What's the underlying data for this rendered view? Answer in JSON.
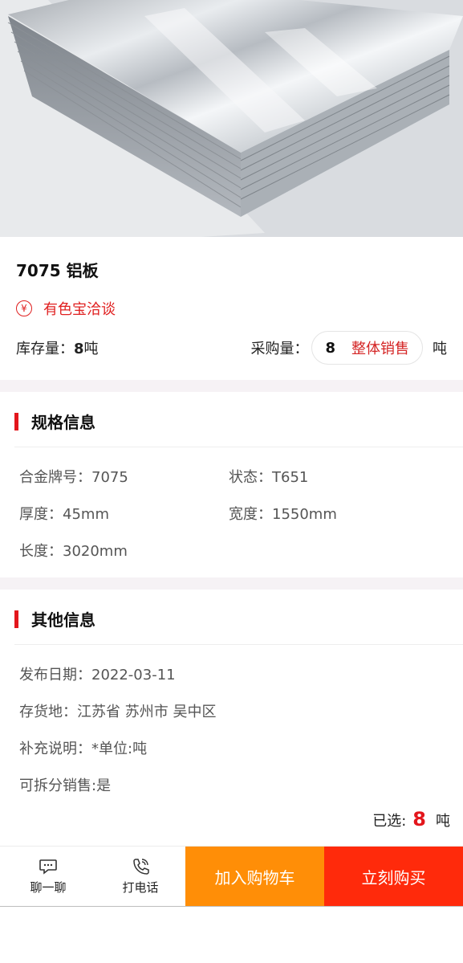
{
  "product": {
    "title": "7075 铝板",
    "negotiate_icon": "yen-icon",
    "negotiate_label": "有色宝洽谈",
    "stock_label": "库存量：",
    "stock_value": "8",
    "stock_unit": "吨",
    "purchase_label": "采购量：",
    "purchase_qty": "8",
    "whole_sale_label": "整体销售",
    "purchase_unit": "吨"
  },
  "specs": {
    "heading": "规格信息",
    "fields": [
      "合金牌号：7075",
      "状态：T651",
      "厚度：45mm",
      "宽度：1550mm",
      "长度：3020mm"
    ]
  },
  "other": {
    "heading": "其他信息",
    "fields": [
      "发布日期：2022-03-11",
      "存货地：江苏省 苏州市 吴中区",
      "补充说明：*单位:吨",
      "可拆分销售:是"
    ]
  },
  "selected": {
    "label": "已选:",
    "value": "8",
    "unit": "吨"
  },
  "bottom_bar": {
    "chat_icon": "chat-icon",
    "chat_label": "聊一聊",
    "phone_icon": "phone-icon",
    "phone_label": "打电话",
    "add_cart_label": "加入购物车",
    "buy_now_label": "立刻购买"
  },
  "colors": {
    "accent_red": "#e3161c",
    "cart_orange": "#ff8e07",
    "buy_red": "#ff2a0b",
    "section_gap": "#f6f2f5"
  }
}
